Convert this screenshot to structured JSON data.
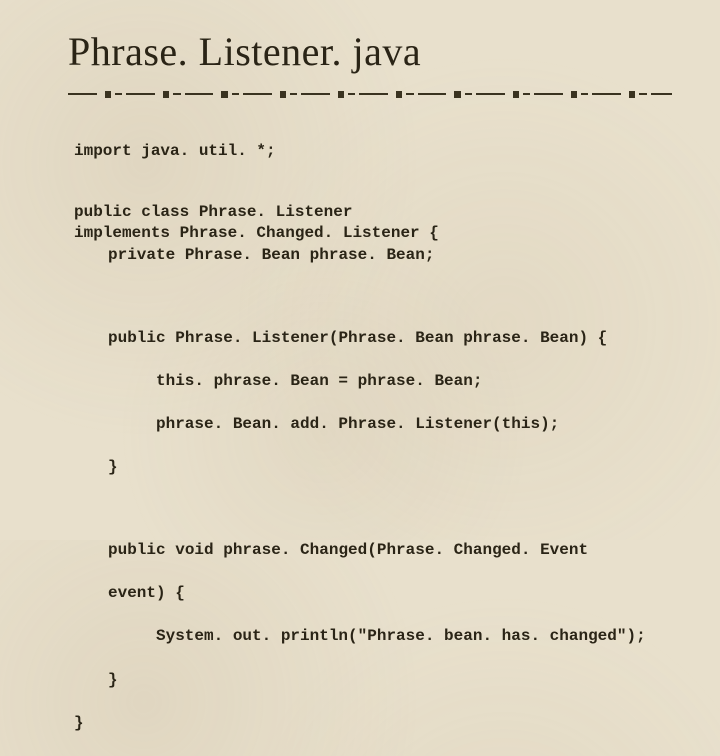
{
  "title": "Phrase. Listener. java",
  "code": {
    "l1": "import java. util. *;",
    "l2": "public class Phrase. Listener",
    "l3": "implements Phrase. Changed. Listener {",
    "l4": "private Phrase. Bean phrase. Bean;",
    "l5": "public Phrase. Listener(Phrase. Bean phrase. Bean) {",
    "l6": "this. phrase. Bean = phrase. Bean;",
    "l7": "phrase. Bean. add. Phrase. Listener(this);",
    "l8": "}",
    "l9": "public void phrase. Changed(Phrase. Changed. Event",
    "l10": "event) {",
    "l11": "System. out. println(\"Phrase. bean. has. changed\");",
    "l12": "}",
    "l13": "}"
  }
}
